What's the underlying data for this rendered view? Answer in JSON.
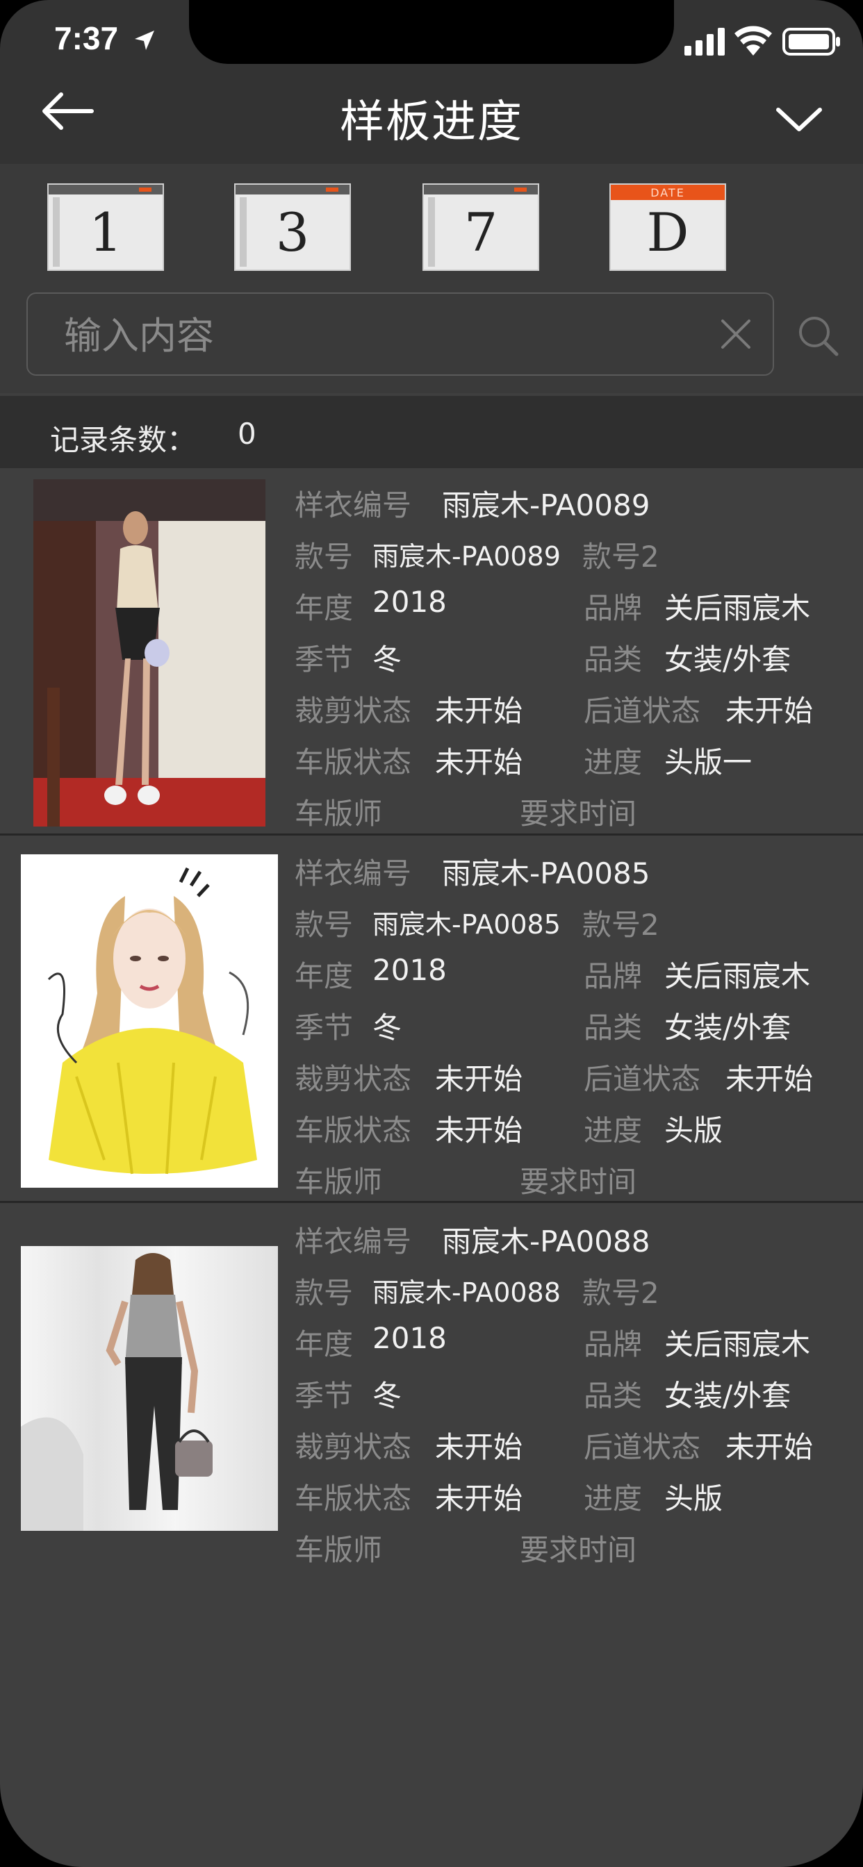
{
  "status": {
    "time": "7:37"
  },
  "nav": {
    "title": "样板进度"
  },
  "date_buttons": [
    {
      "label": "1",
      "icon": "calendar-icon"
    },
    {
      "label": "3",
      "icon": "calendar-icon"
    },
    {
      "label": "7",
      "icon": "calendar-icon"
    },
    {
      "label": "D",
      "cap": "DATE",
      "icon": "calendar-date-icon"
    }
  ],
  "search": {
    "placeholder": "输入内容",
    "value": ""
  },
  "records": {
    "label": "记录条数：",
    "count": "0"
  },
  "labels": {
    "sample_no": "样衣编号",
    "style_no": "款号",
    "style_no2": "款号2",
    "year": "年度",
    "brand": "品牌",
    "season": "季节",
    "category": "品类",
    "cut_status": "裁剪状态",
    "back_status": "后道状态",
    "sew_status": "车版状态",
    "progress": "进度",
    "sewer": "车版师",
    "required_time": "要求时间"
  },
  "items": [
    {
      "sample_no": "雨宸木-PA0089",
      "style_no": "雨宸木-PA0089",
      "year": "2018",
      "brand": "关后雨宸木",
      "season": "冬",
      "category": "女装/外套",
      "cut_status": "未开始",
      "back_status": "未开始",
      "sew_status": "未开始",
      "progress": "头版一",
      "image": "runway-model-photo"
    },
    {
      "sample_no": "雨宸木-PA0085",
      "style_no": "雨宸木-PA0085",
      "year": "2018",
      "brand": "关后雨宸木",
      "season": "冬",
      "category": "女装/外套",
      "cut_status": "未开始",
      "back_status": "未开始",
      "sew_status": "未开始",
      "progress": "头版",
      "image": "fashion-illustration"
    },
    {
      "sample_no": "雨宸木-PA0088",
      "style_no": "雨宸木-PA0088",
      "year": "2018",
      "brand": "关后雨宸木",
      "season": "冬",
      "category": "女装/外套",
      "cut_status": "未开始",
      "back_status": "未开始",
      "sew_status": "未开始",
      "progress": "头版",
      "image": "studio-model-photo"
    }
  ]
}
